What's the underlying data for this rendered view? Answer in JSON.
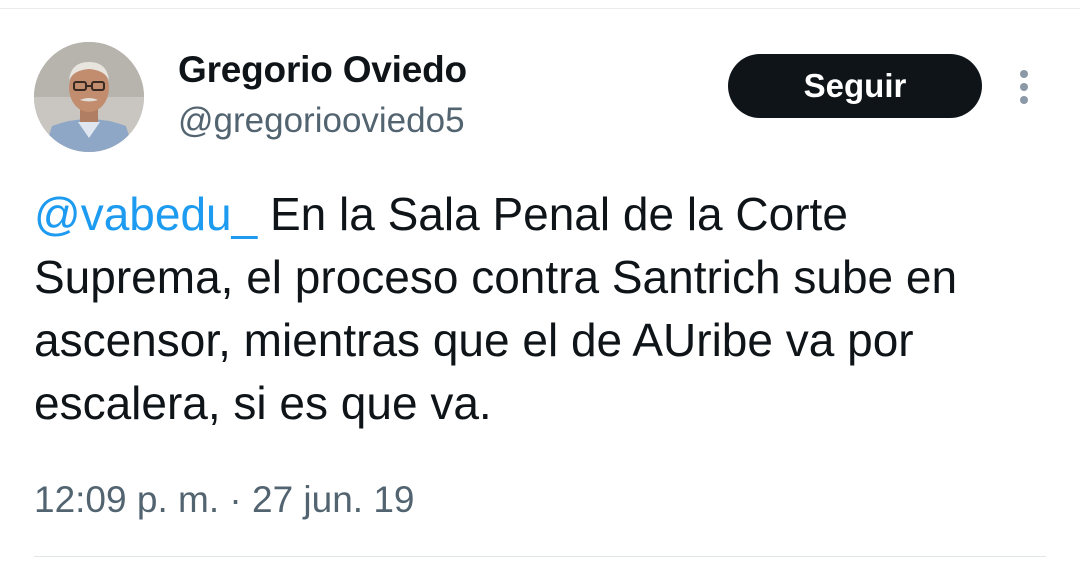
{
  "tweet": {
    "author": {
      "display_name": "Gregorio Oviedo",
      "handle": "@gregoriooviedo5",
      "avatar_icon": "profile-photo"
    },
    "follow_label": "Seguir",
    "more_icon": "more-vertical-icon",
    "mention": "@vabedu_",
    "body_text": " En la Sala Penal de la Corte Suprema, el proceso contra Santrich sube en ascensor, mientras que el de AUribe va por escalera, si es que va.",
    "timestamp": "12:09 p. m. · 27 jun. 19"
  },
  "colors": {
    "text": "#0f1419",
    "secondary": "#536471",
    "link": "#1d9bf0",
    "button_bg": "#0f1419",
    "button_text": "#ffffff"
  }
}
